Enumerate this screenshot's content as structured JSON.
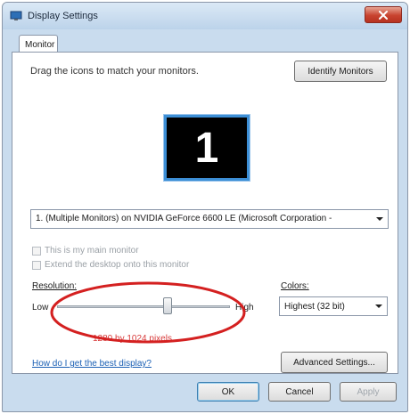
{
  "window": {
    "title": "Display Settings",
    "close_icon": "close-icon"
  },
  "tabs": [
    {
      "label": "Monitor",
      "selected": true
    }
  ],
  "monitor_tab": {
    "instruction": "Drag the icons to match your monitors.",
    "identify_button": "Identify Monitors",
    "monitor_tile_number": "1",
    "monitor_select": {
      "value": "1. (Multiple Monitors) on NVIDIA GeForce 6600 LE (Microsoft Corporation - "
    },
    "checkboxes": [
      {
        "label": "This is my main monitor",
        "checked": false,
        "enabled": false
      },
      {
        "label": "Extend the desktop onto this monitor",
        "checked": false,
        "enabled": false
      }
    ],
    "resolution": {
      "label": "Resolution:",
      "low_label": "Low",
      "high_label": "High",
      "slider_fraction": 0.64,
      "value_text": "1280 by 1024 pixels"
    },
    "colors": {
      "label": "Colors:",
      "value": "Highest (32 bit)"
    },
    "help_link": "How do I get the best display?",
    "advanced_button": "Advanced Settings..."
  },
  "footer": {
    "ok": "OK",
    "cancel": "Cancel",
    "apply": "Apply"
  },
  "colors": {
    "titlebar": "#c9dcee",
    "close_button": "#c8432f",
    "annotation": "#d42020",
    "monitor_border": "#3d8fd6",
    "link": "#1a5fb4"
  }
}
